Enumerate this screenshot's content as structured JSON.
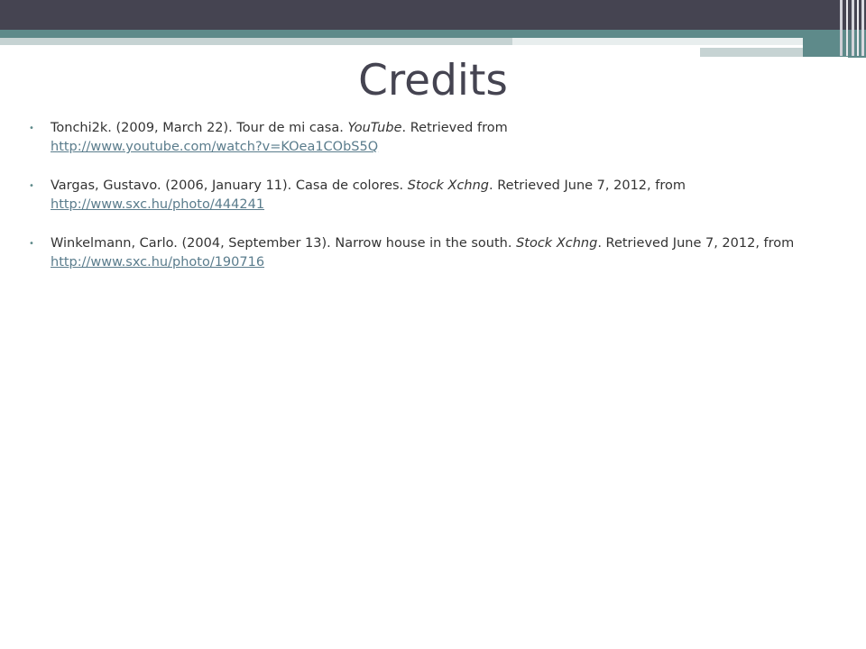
{
  "slide": {
    "title": "Credits",
    "bullet_marker": "•",
    "colors": {
      "header_dark": "#454451",
      "accent_teal": "#5e8a8a",
      "title_text": "#454451",
      "body_text": "#333333",
      "link": "#5a7c8c"
    },
    "credits": [
      {
        "author_date": "Tonchi2k.  (2009,  March 22).  ",
        "title": "Tour de mi casa.  ",
        "source": "YouTube",
        "retrieved": ".  Retrieved from ",
        "url": "http://www.youtube.com/watch?v=KOea1CObS5Q"
      },
      {
        "author_date": "Vargas, Gustavo.  (2006,  January 11).  ",
        "title": "Casa de colores.  ",
        "source": "Stock Xchng",
        "retrieved": ".  Retrieved June 7,  2012,  from ",
        "url": "http://www.sxc.hu/photo/444241"
      },
      {
        "author_date": "Winkelmann, Carlo.  (2004, September 13).  ",
        "title": "Narrow house in the south.  ",
        "source": "Stock Xchng",
        "retrieved": ".  Retrieved June 7,  2012,  from ",
        "url": "http://www.sxc.hu/photo/190716"
      }
    ]
  }
}
